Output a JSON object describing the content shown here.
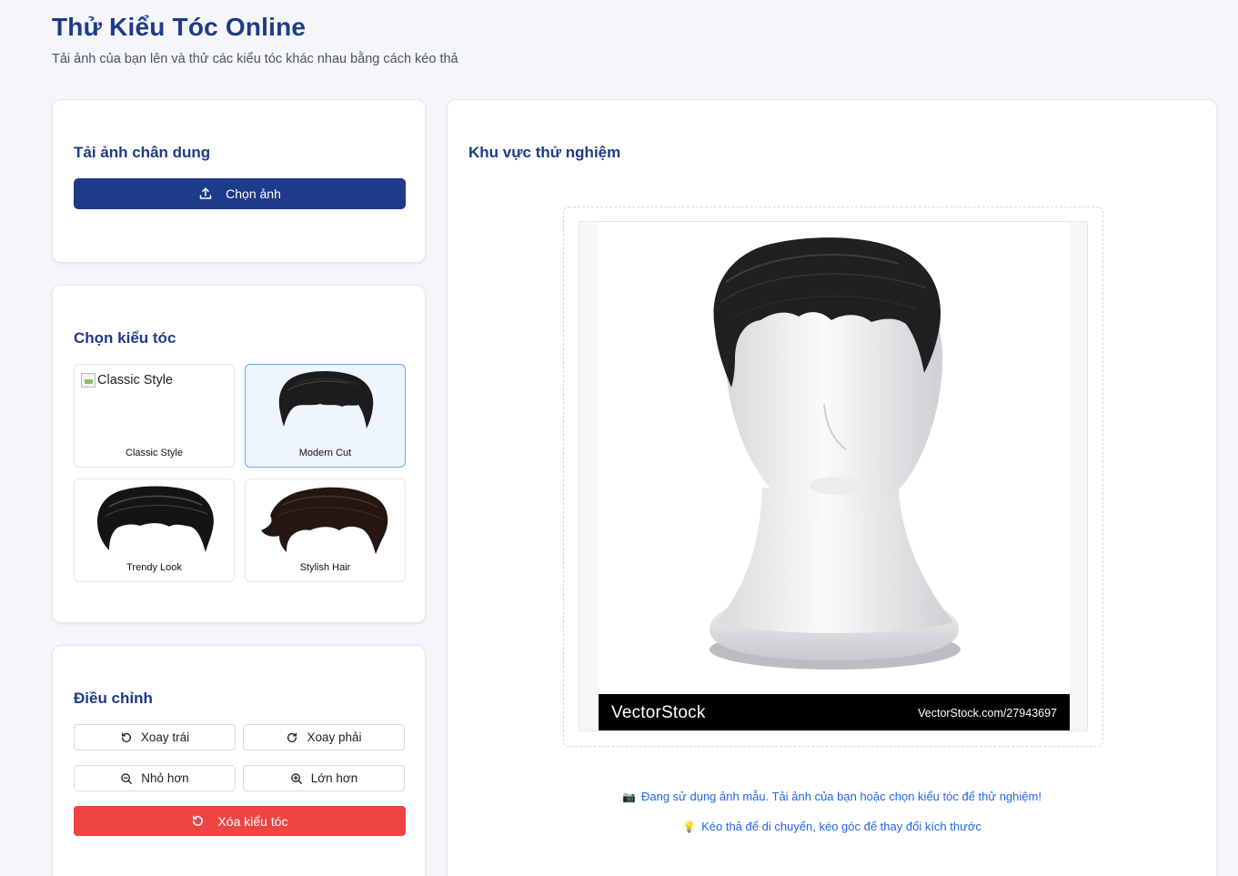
{
  "header": {
    "title": "Thử Kiểu Tóc Online",
    "subtitle": "Tải ảnh của bạn lên và thử các kiểu tóc khác nhau bằng cách kéo thả"
  },
  "upload": {
    "title": "Tải ảnh chân dung",
    "button_label": "Chọn ảnh",
    "button_icon": "upload-icon"
  },
  "hairstyles": {
    "title": "Chọn kiểu tóc",
    "items": [
      {
        "label": "Classic Style",
        "alt": "Classic Style",
        "image_broken": true,
        "selected": false
      },
      {
        "label": "Modern Cut",
        "selected": true
      },
      {
        "label": "Trendy Look",
        "selected": false
      },
      {
        "label": "Stylish Hair",
        "selected": false
      }
    ]
  },
  "adjust": {
    "title": "Điều chỉnh",
    "rotate_left": "Xoay trái",
    "rotate_right": "Xoay phải",
    "smaller": "Nhỏ hơn",
    "bigger": "Lớn hơn",
    "remove": "Xóa kiểu tóc"
  },
  "test_area": {
    "title": "Khu vực thử nghiệm",
    "watermark_brand": "VectorStock",
    "watermark_url": "VectorStock.com/27943697",
    "hint_1_icon": "📷",
    "hint_1": "Đang sử dụng ảnh mẫu. Tải ảnh của bạn hoặc chọn kiểu tóc để thử nghiệm!",
    "hint_2_icon": "💡",
    "hint_2": "Kéo thả để di chuyển, kéo góc để thay đổi kích thước"
  },
  "colors": {
    "primary": "#1e3a8a",
    "danger": "#ef4444",
    "link": "#2563eb",
    "selected_bg": "#eef5ff",
    "selected_border": "#60a5fa"
  }
}
